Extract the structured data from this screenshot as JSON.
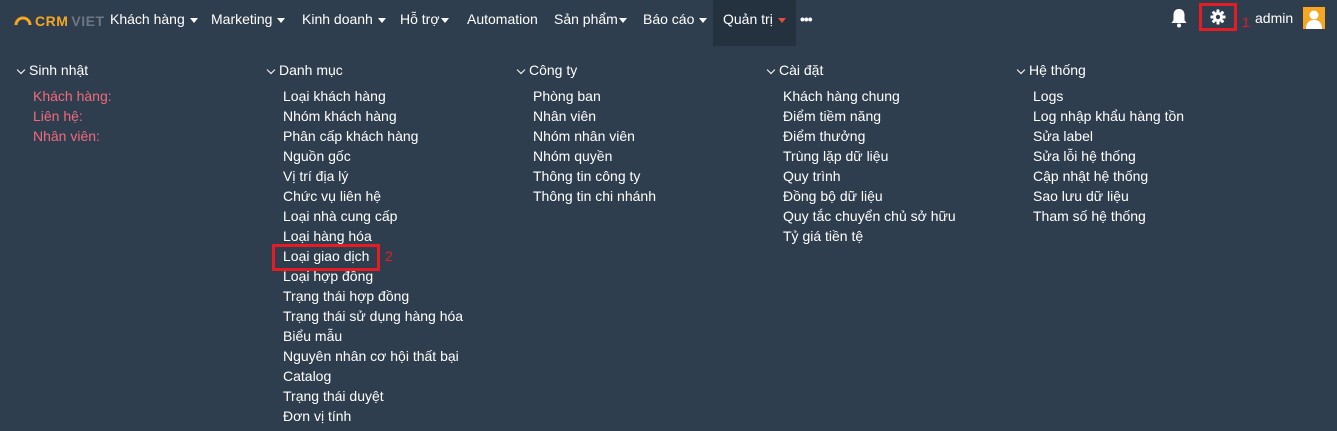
{
  "brand": {
    "part1": "CRM",
    "part2": "VIET"
  },
  "nav": [
    {
      "label": "Khách hàng",
      "caret": true
    },
    {
      "label": "Marketing",
      "caret": true
    },
    {
      "label": "Kinh doanh",
      "caret": true
    },
    {
      "label": "Hỗ trợ",
      "caret": true
    },
    {
      "label": "Automation",
      "caret": false
    },
    {
      "label": "Sản phẩm",
      "caret": true
    },
    {
      "label": "Báo cáo",
      "caret": true
    },
    {
      "label": "Quản trị",
      "caret": true,
      "active": true
    }
  ],
  "more": "•••",
  "user": {
    "name": "admin"
  },
  "annotations": {
    "gear_marker": "1",
    "item_marker": "2"
  },
  "columns": [
    {
      "heading": "Sinh nhật",
      "items": [
        "Khách hàng:",
        "Liên hệ:",
        "Nhân viên:"
      ]
    },
    {
      "heading": "Danh mục",
      "items": [
        "Loại khách hàng",
        "Nhóm khách hàng",
        "Phân cấp khách hàng",
        "Nguồn gốc",
        "Vị trí địa lý",
        "Chức vụ liên hệ",
        "Loại nhà cung cấp",
        "Loại hàng hóa",
        "Loại giao dịch",
        "Loại hợp đồng",
        "Trạng thái hợp đồng",
        "Trạng thái sử dụng hàng hóa",
        "Biểu mẫu",
        "Nguyên nhân cơ hội thất bại",
        "Catalog",
        "Trạng thái duyệt",
        "Đơn vị tính"
      ]
    },
    {
      "heading": "Công ty",
      "items": [
        "Phòng ban",
        "Nhân viên",
        "Nhóm nhân viên",
        "Nhóm quyền",
        "Thông tin công ty",
        "Thông tin chi nhánh"
      ]
    },
    {
      "heading": "Cài đặt",
      "items": [
        "Khách hàng chung",
        "Điểm tiềm năng",
        "Điểm thưởng",
        "Trùng lặp dữ liệu",
        "Quy trình",
        "Đồng bộ dữ liệu",
        "Quy tắc chuyển chủ sở hữu",
        "Tỷ giá tiền tệ"
      ]
    },
    {
      "heading": "Hệ thống",
      "items": [
        "Logs",
        "Log nhập khẩu hàng tồn",
        "Sửa label",
        "Sửa lỗi hệ thống",
        "Cập nhật hệ thống",
        "Sao lưu dữ liệu",
        "Tham số hệ thống"
      ]
    }
  ],
  "colors": {
    "background": "#2f3e4e",
    "active_nav": "#243240",
    "accent_red": "#e51c23",
    "pink_text": "#f06a7d",
    "logo_orange": "#f5a623"
  },
  "icons": [
    "logo-icon",
    "bell-icon",
    "gear-icon",
    "avatar-icon",
    "chevron-down-icon"
  ]
}
